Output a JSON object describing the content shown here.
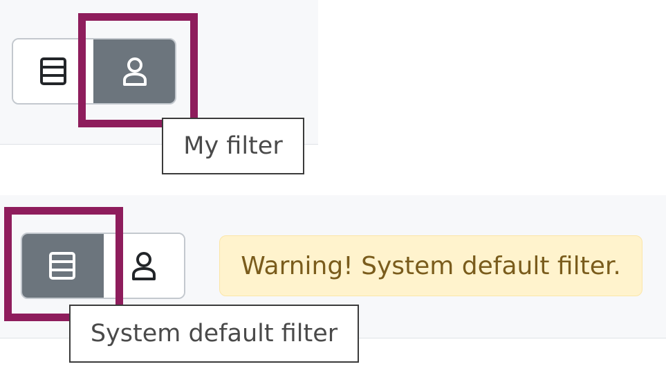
{
  "top_example": {
    "buttons": [
      {
        "icon": "server-icon",
        "active": false
      },
      {
        "icon": "user-icon",
        "active": true
      }
    ],
    "tooltip": "My filter"
  },
  "bottom_example": {
    "buttons": [
      {
        "icon": "server-icon",
        "active": true
      },
      {
        "icon": "user-icon",
        "active": false
      }
    ],
    "tooltip": "System default filter",
    "warning": "Warning! System default filter."
  },
  "colors": {
    "active_button": "#6c757d",
    "highlight": "#8e1d5c",
    "warning_background": "#fff3cd",
    "warning_text": "#7a5c1c"
  }
}
